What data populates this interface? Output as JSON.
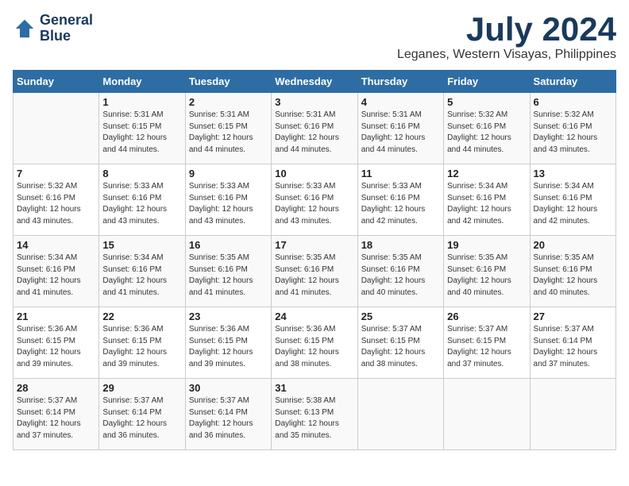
{
  "logo": {
    "line1": "General",
    "line2": "Blue"
  },
  "title": "July 2024",
  "location": "Leganes, Western Visayas, Philippines",
  "days_of_week": [
    "Sunday",
    "Monday",
    "Tuesday",
    "Wednesday",
    "Thursday",
    "Friday",
    "Saturday"
  ],
  "weeks": [
    [
      {
        "day": "",
        "info": ""
      },
      {
        "day": "1",
        "info": "Sunrise: 5:31 AM\nSunset: 6:15 PM\nDaylight: 12 hours\nand 44 minutes."
      },
      {
        "day": "2",
        "info": "Sunrise: 5:31 AM\nSunset: 6:15 PM\nDaylight: 12 hours\nand 44 minutes."
      },
      {
        "day": "3",
        "info": "Sunrise: 5:31 AM\nSunset: 6:16 PM\nDaylight: 12 hours\nand 44 minutes."
      },
      {
        "day": "4",
        "info": "Sunrise: 5:31 AM\nSunset: 6:16 PM\nDaylight: 12 hours\nand 44 minutes."
      },
      {
        "day": "5",
        "info": "Sunrise: 5:32 AM\nSunset: 6:16 PM\nDaylight: 12 hours\nand 44 minutes."
      },
      {
        "day": "6",
        "info": "Sunrise: 5:32 AM\nSunset: 6:16 PM\nDaylight: 12 hours\nand 43 minutes."
      }
    ],
    [
      {
        "day": "7",
        "info": "Sunrise: 5:32 AM\nSunset: 6:16 PM\nDaylight: 12 hours\nand 43 minutes."
      },
      {
        "day": "8",
        "info": "Sunrise: 5:33 AM\nSunset: 6:16 PM\nDaylight: 12 hours\nand 43 minutes."
      },
      {
        "day": "9",
        "info": "Sunrise: 5:33 AM\nSunset: 6:16 PM\nDaylight: 12 hours\nand 43 minutes."
      },
      {
        "day": "10",
        "info": "Sunrise: 5:33 AM\nSunset: 6:16 PM\nDaylight: 12 hours\nand 43 minutes."
      },
      {
        "day": "11",
        "info": "Sunrise: 5:33 AM\nSunset: 6:16 PM\nDaylight: 12 hours\nand 42 minutes."
      },
      {
        "day": "12",
        "info": "Sunrise: 5:34 AM\nSunset: 6:16 PM\nDaylight: 12 hours\nand 42 minutes."
      },
      {
        "day": "13",
        "info": "Sunrise: 5:34 AM\nSunset: 6:16 PM\nDaylight: 12 hours\nand 42 minutes."
      }
    ],
    [
      {
        "day": "14",
        "info": "Sunrise: 5:34 AM\nSunset: 6:16 PM\nDaylight: 12 hours\nand 41 minutes."
      },
      {
        "day": "15",
        "info": "Sunrise: 5:34 AM\nSunset: 6:16 PM\nDaylight: 12 hours\nand 41 minutes."
      },
      {
        "day": "16",
        "info": "Sunrise: 5:35 AM\nSunset: 6:16 PM\nDaylight: 12 hours\nand 41 minutes."
      },
      {
        "day": "17",
        "info": "Sunrise: 5:35 AM\nSunset: 6:16 PM\nDaylight: 12 hours\nand 41 minutes."
      },
      {
        "day": "18",
        "info": "Sunrise: 5:35 AM\nSunset: 6:16 PM\nDaylight: 12 hours\nand 40 minutes."
      },
      {
        "day": "19",
        "info": "Sunrise: 5:35 AM\nSunset: 6:16 PM\nDaylight: 12 hours\nand 40 minutes."
      },
      {
        "day": "20",
        "info": "Sunrise: 5:35 AM\nSunset: 6:16 PM\nDaylight: 12 hours\nand 40 minutes."
      }
    ],
    [
      {
        "day": "21",
        "info": "Sunrise: 5:36 AM\nSunset: 6:15 PM\nDaylight: 12 hours\nand 39 minutes."
      },
      {
        "day": "22",
        "info": "Sunrise: 5:36 AM\nSunset: 6:15 PM\nDaylight: 12 hours\nand 39 minutes."
      },
      {
        "day": "23",
        "info": "Sunrise: 5:36 AM\nSunset: 6:15 PM\nDaylight: 12 hours\nand 39 minutes."
      },
      {
        "day": "24",
        "info": "Sunrise: 5:36 AM\nSunset: 6:15 PM\nDaylight: 12 hours\nand 38 minutes."
      },
      {
        "day": "25",
        "info": "Sunrise: 5:37 AM\nSunset: 6:15 PM\nDaylight: 12 hours\nand 38 minutes."
      },
      {
        "day": "26",
        "info": "Sunrise: 5:37 AM\nSunset: 6:15 PM\nDaylight: 12 hours\nand 37 minutes."
      },
      {
        "day": "27",
        "info": "Sunrise: 5:37 AM\nSunset: 6:14 PM\nDaylight: 12 hours\nand 37 minutes."
      }
    ],
    [
      {
        "day": "28",
        "info": "Sunrise: 5:37 AM\nSunset: 6:14 PM\nDaylight: 12 hours\nand 37 minutes."
      },
      {
        "day": "29",
        "info": "Sunrise: 5:37 AM\nSunset: 6:14 PM\nDaylight: 12 hours\nand 36 minutes."
      },
      {
        "day": "30",
        "info": "Sunrise: 5:37 AM\nSunset: 6:14 PM\nDaylight: 12 hours\nand 36 minutes."
      },
      {
        "day": "31",
        "info": "Sunrise: 5:38 AM\nSunset: 6:13 PM\nDaylight: 12 hours\nand 35 minutes."
      },
      {
        "day": "",
        "info": ""
      },
      {
        "day": "",
        "info": ""
      },
      {
        "day": "",
        "info": ""
      }
    ]
  ]
}
